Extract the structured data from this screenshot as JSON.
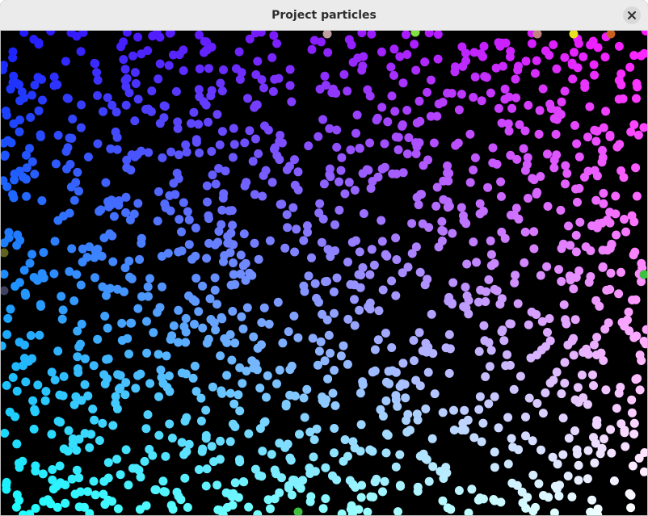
{
  "window": {
    "title": "Project particles"
  },
  "icons": {
    "close": "close-icon"
  },
  "canvas": {
    "background": "#000000",
    "corner_colors": {
      "top_left": "#1a1aff",
      "top_right": "#ff1aff",
      "bottom_left": "#1affff",
      "bottom_right": "#ffffff"
    }
  }
}
